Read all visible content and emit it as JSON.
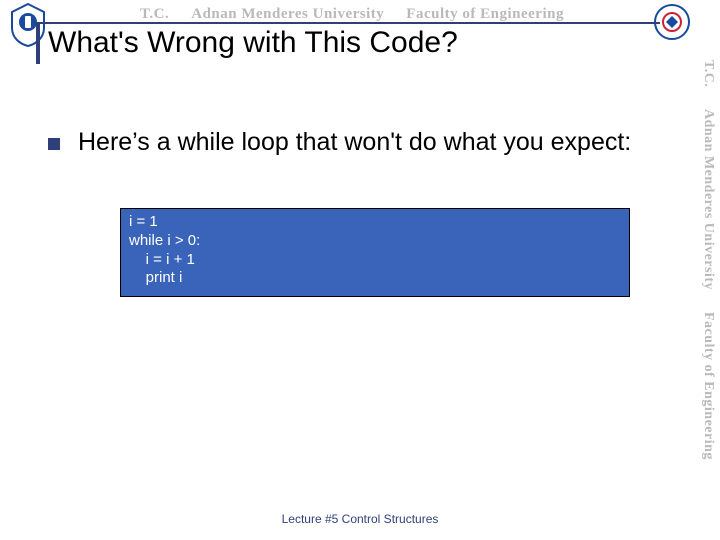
{
  "watermark": {
    "tc": "T.C.",
    "uni": "Adnan Menderes University",
    "fac": "Faculty of Engineering"
  },
  "title": "What's Wrong with This Code?",
  "bullet": "Here’s a while loop that won't do what you expect:",
  "code": {
    "l1": "i = 1",
    "l2": "while i > 0:",
    "l3": "    i = i + 1",
    "l4": "    print i"
  },
  "footer": "Lecture #5 Control Structures"
}
